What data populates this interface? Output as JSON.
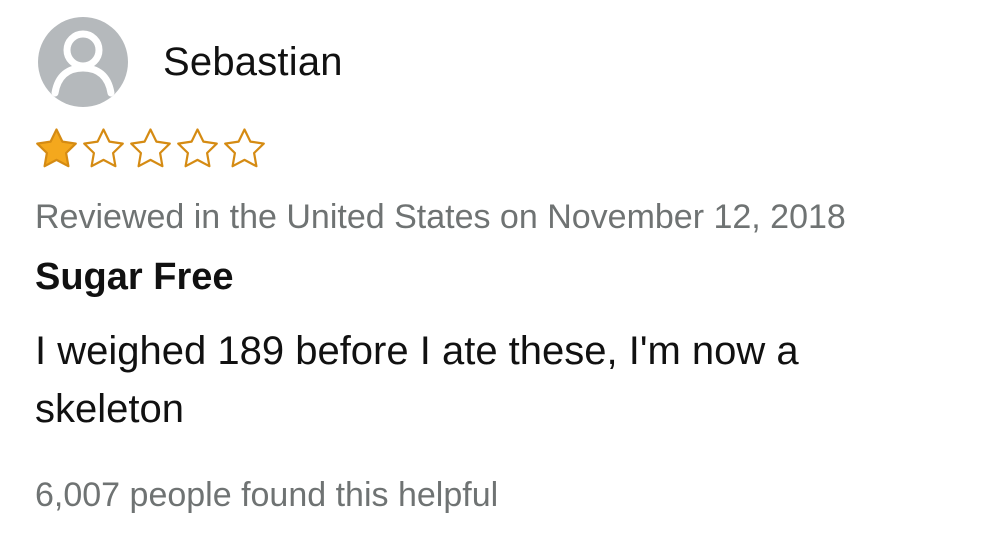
{
  "review": {
    "profile_name": "Sebastian",
    "avatar_icon": "default-user-avatar-icon",
    "rating": {
      "value": 1,
      "max": 5,
      "filled_color": "#f4a81d",
      "outline_color": "#d58b13"
    },
    "meta": "Reviewed in the United States on November 12, 2018",
    "title": "Sugar Free",
    "body": "I weighed 189 before I ate these, I'm now a skeleton",
    "helpful_text": "6,007 people found this helpful"
  }
}
